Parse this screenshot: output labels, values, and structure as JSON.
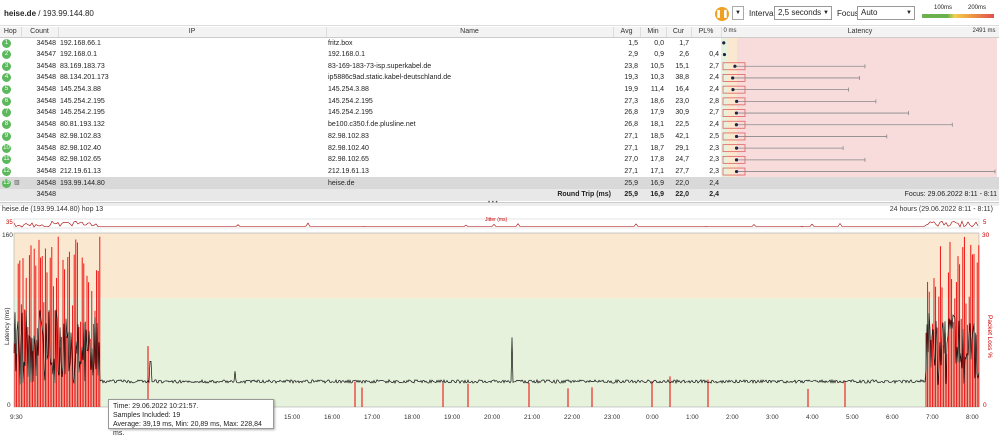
{
  "header": {
    "host": "heise.de",
    "separator": " / ",
    "ip": "193.99.144.80",
    "interval_label": "Interval",
    "interval_value": "2,5 seconds",
    "focus_label": "Focus",
    "focus_value": "Auto",
    "legend_100": "100ms",
    "legend_200": "200ms"
  },
  "columns": {
    "hop": "Hop",
    "count": "Count",
    "ip": "IP",
    "name": "Name",
    "avg": "Avg",
    "min": "Min",
    "cur": "Cur",
    "pl": "PL%",
    "latency": "Latency",
    "lat_min": "0 ms",
    "lat_max": "2491 ms"
  },
  "hops": [
    {
      "hop": "1",
      "count": "34548",
      "ip": "192.168.66.1",
      "name": "fritz.box",
      "avg": "1,5",
      "min": "0,0",
      "cur": "1,7",
      "pl": "",
      "lat_avg": 1.5,
      "lat_max": 4
    },
    {
      "hop": "2",
      "count": "34547",
      "ip": "192.168.0.1",
      "name": "192.168.0.1",
      "avg": "2,9",
      "min": "0,9",
      "cur": "2,6",
      "pl": "0,4",
      "lat_avg": 2.9,
      "lat_max": 8
    },
    {
      "hop": "3",
      "count": "34548",
      "ip": "83.169.183.73",
      "name": "83-169-183-73-isp.superkabel.de",
      "avg": "23,8",
      "min": "10,5",
      "cur": "15,1",
      "pl": "2,7",
      "lat_avg": 23.8,
      "lat_max": 1300
    },
    {
      "hop": "4",
      "count": "34548",
      "ip": "88.134.201.173",
      "name": "ip5886c9ad.static.kabel-deutschland.de",
      "avg": "19,3",
      "min": "10,3",
      "cur": "38,8",
      "pl": "2,4",
      "lat_avg": 19.3,
      "lat_max": 1250
    },
    {
      "hop": "5",
      "count": "34548",
      "ip": "145.254.3.88",
      "name": "145.254.3.88",
      "avg": "19,9",
      "min": "11,4",
      "cur": "16,4",
      "pl": "2,4",
      "lat_avg": 19.9,
      "lat_max": 1150
    },
    {
      "hop": "6",
      "count": "34548",
      "ip": "145.254.2.195",
      "name": "145.254.2.195",
      "avg": "27,3",
      "min": "18,6",
      "cur": "23,0",
      "pl": "2,8",
      "lat_avg": 27.3,
      "lat_max": 1400
    },
    {
      "hop": "7",
      "count": "34548",
      "ip": "145.254.2.195",
      "name": "145.254.2.195",
      "avg": "26,8",
      "min": "17,9",
      "cur": "30,9",
      "pl": "2,7",
      "lat_avg": 26.8,
      "lat_max": 1700
    },
    {
      "hop": "8",
      "count": "34548",
      "ip": "80.81.193.132",
      "name": "be100.c350.f.de.plusline.net",
      "avg": "26,8",
      "min": "18,1",
      "cur": "22,5",
      "pl": "2,4",
      "lat_avg": 26.8,
      "lat_max": 2100
    },
    {
      "hop": "9",
      "count": "34548",
      "ip": "82.98.102.83",
      "name": "82.98.102.83",
      "avg": "27,1",
      "min": "18,5",
      "cur": "42,1",
      "pl": "2,5",
      "lat_avg": 27.1,
      "lat_max": 1500
    },
    {
      "hop": "10",
      "count": "34548",
      "ip": "82.98.102.40",
      "name": "82.98.102.40",
      "avg": "27,1",
      "min": "18,7",
      "cur": "29,1",
      "pl": "2,3",
      "lat_avg": 27.1,
      "lat_max": 1100
    },
    {
      "hop": "11",
      "count": "34548",
      "ip": "82.98.102.65",
      "name": "82.98.102.65",
      "avg": "27,0",
      "min": "17,8",
      "cur": "24,7",
      "pl": "2,3",
      "lat_avg": 27.0,
      "lat_max": 1300
    },
    {
      "hop": "12",
      "count": "34548",
      "ip": "212.19.61.13",
      "name": "212.19.61.13",
      "avg": "27,1",
      "min": "17,1",
      "cur": "27,7",
      "pl": "2,3",
      "lat_avg": 27.1,
      "lat_max": 2491
    },
    {
      "hop": "13",
      "count": "34548",
      "ip": "193.99.144.80",
      "name": "heise.de",
      "avg": "25,9",
      "min": "16,9",
      "cur": "22,0",
      "pl": "2,4",
      "lat_avg": 25.9,
      "lat_max": 1400
    }
  ],
  "summary": {
    "count": "34548",
    "label": "Round Trip (ms)",
    "avg": "25,9",
    "min": "16,9",
    "cur": "22,0",
    "pl": "2,4",
    "focus": "Focus: 29.06.2022 8:11 - 8:11"
  },
  "chart": {
    "title": "heise.de (193.99.144.80) hop 13",
    "range": "24 hours (29.06.2022 8:11 - 8:11)",
    "jitter_label": "Jitter (ms)",
    "jitter_max": "35",
    "jitter_right": "5",
    "y_max": "160",
    "y_min": "0",
    "y_label": "Latency (ms)",
    "pl_label": "Packet Loss %",
    "pl_max": "30",
    "pl_min": "0",
    "x_ticks": [
      "9:30",
      "15:00",
      "16:00",
      "17:00",
      "18:00",
      "19:00",
      "20:00",
      "21:00",
      "22:00",
      "23:00",
      "0:00",
      "1:00",
      "2:00",
      "3:00",
      "4:00",
      "5:00",
      "6:00",
      "7:00",
      "8:00"
    ],
    "colors": {
      "green": "#e6f2dc",
      "orange": "#fbe8d0",
      "red": "#f8dcdc",
      "loss": "#ee0000",
      "line": "#111111"
    }
  },
  "tooltip": {
    "time": "Time: 29.06.2022 10:21:57.",
    "samples": "Samples Included: 19",
    "stats": "Average: 39,19 ms, Min: 20,89 ms, Max: 228,84 ms."
  }
}
